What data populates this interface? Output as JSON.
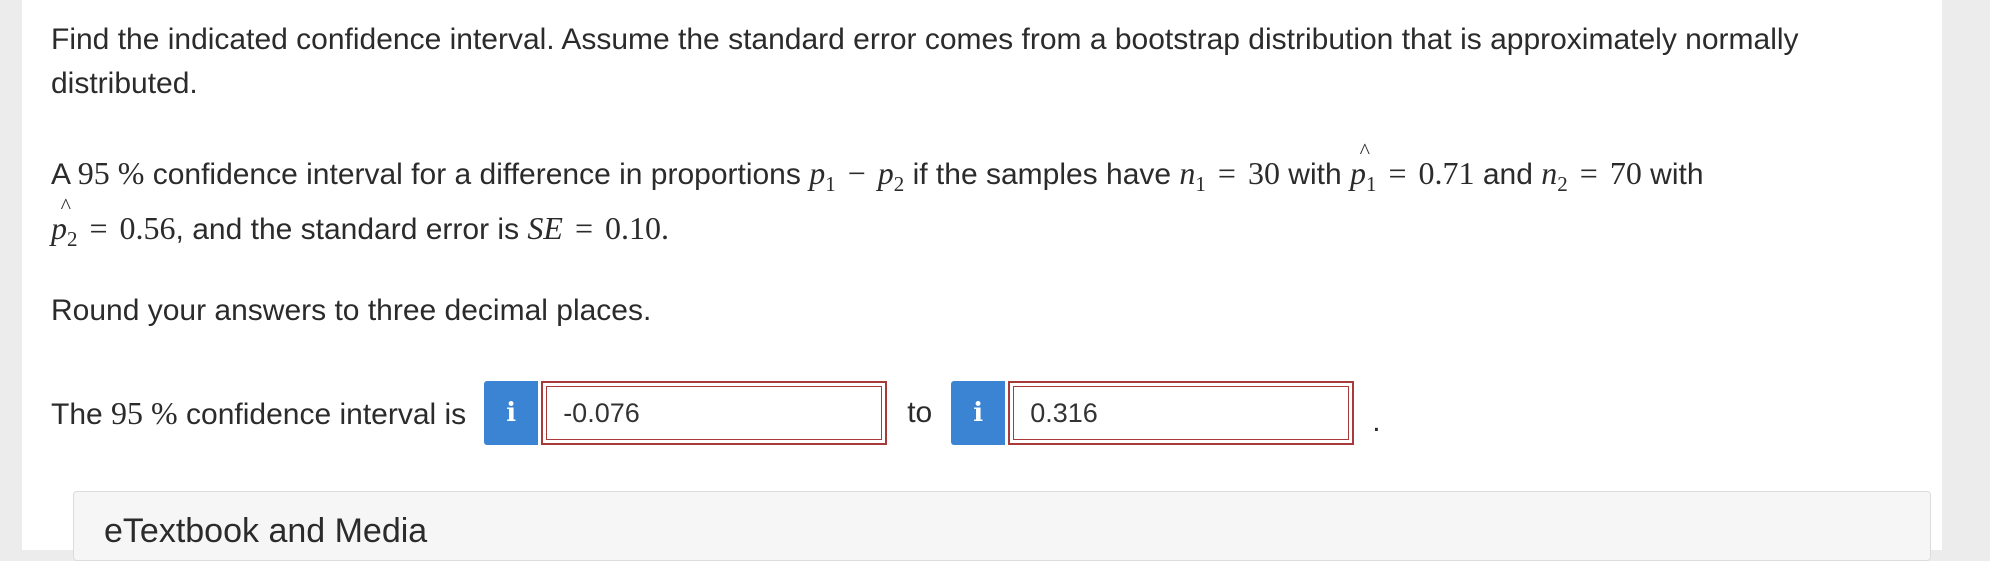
{
  "question": {
    "intro": "Find the indicated confidence interval. Assume the standard error comes from a bootstrap distribution that is approximately normally distributed.",
    "problem": {
      "t1": "A ",
      "conf_level": "95 %",
      "t2": "  confidence interval for a difference in proportions ",
      "t3": " if the samples have ",
      "n1_value": "30",
      "t4": " with ",
      "p1hat_value": "0.71",
      "t5": " and ",
      "n2_value": "70",
      "t6": " with",
      "p2hat_value": "0.56",
      "t7": ", and the standard error is ",
      "se_label": "SE",
      "se_value": "0.10",
      "t8": "."
    },
    "rounding": "Round your answers to three decimal places.",
    "answer": {
      "lead_prefix": "The ",
      "conf_level": "95 %",
      "lead_suffix": "  confidence interval is",
      "info_glyph": "i",
      "lower_value": "-0.076",
      "to_label": "to",
      "upper_value": "0.316",
      "period": "."
    }
  },
  "etextbook": {
    "label": "eTextbook and Media"
  },
  "colors": {
    "info_button": "#3b84d4",
    "error_border": "#a83a3a"
  }
}
